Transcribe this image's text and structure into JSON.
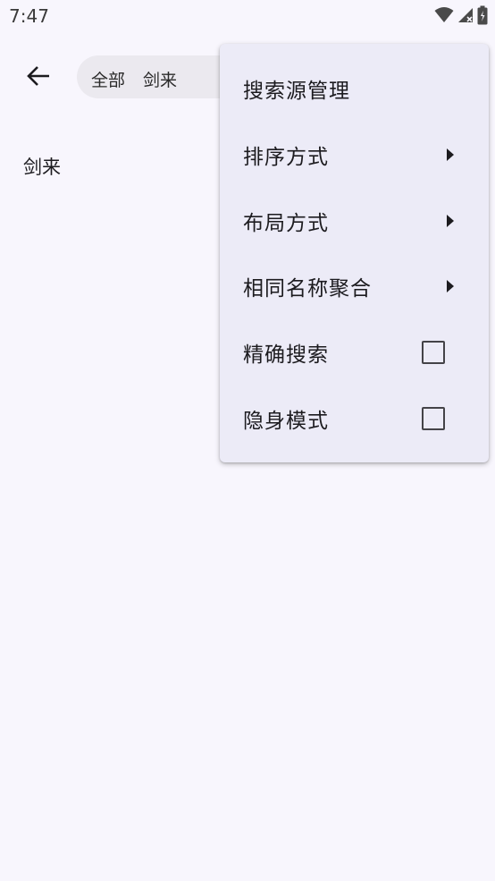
{
  "status_bar": {
    "time": "7:47",
    "icons": [
      "wifi-icon",
      "signal-icon",
      "battery-icon"
    ]
  },
  "toolbar": {
    "back_icon": "arrow-back-icon",
    "search_scope": "全部",
    "search_query": "剑来"
  },
  "results": [
    {
      "title": "剑来"
    }
  ],
  "menu": {
    "items": [
      {
        "label": "搜索源管理",
        "type": "action"
      },
      {
        "label": "排序方式",
        "type": "submenu"
      },
      {
        "label": "布局方式",
        "type": "submenu"
      },
      {
        "label": "相同名称聚合",
        "type": "submenu"
      },
      {
        "label": "精确搜索",
        "type": "checkbox",
        "checked": false
      },
      {
        "label": "隐身模式",
        "type": "checkbox",
        "checked": false
      }
    ]
  },
  "colors": {
    "background": "#f8f6fd",
    "menu_background": "#ecebf7",
    "search_background": "#ebe9ef",
    "text": "#1c1b1f"
  }
}
